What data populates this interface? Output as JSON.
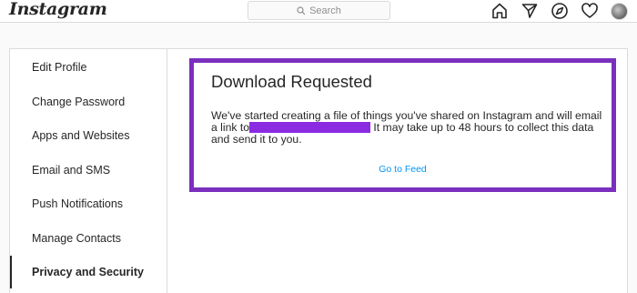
{
  "header": {
    "logo_text": "Instagram",
    "search_placeholder": "Search",
    "icons": [
      "home-icon",
      "direct-icon",
      "explore-icon",
      "activity-heart-icon",
      "profile-avatar"
    ]
  },
  "sidebar": {
    "items": [
      {
        "label": "Edit Profile",
        "active": false
      },
      {
        "label": "Change Password",
        "active": false
      },
      {
        "label": "Apps and Websites",
        "active": false
      },
      {
        "label": "Email and SMS",
        "active": false
      },
      {
        "label": "Push Notifications",
        "active": false
      },
      {
        "label": "Manage Contacts",
        "active": false
      },
      {
        "label": "Privacy and Security",
        "active": true
      }
    ]
  },
  "main": {
    "title": "Download Requested",
    "message_part1": "We've started creating a file of things you've shared on Instagram and will email a link to",
    "message_part2": " It may take up to 48 hours to collect this data and send it to you.",
    "link_label": "Go to Feed"
  },
  "colors": {
    "highlight_border": "#7b2fbe",
    "redaction": "#8a2be2",
    "link": "#0095f6"
  }
}
